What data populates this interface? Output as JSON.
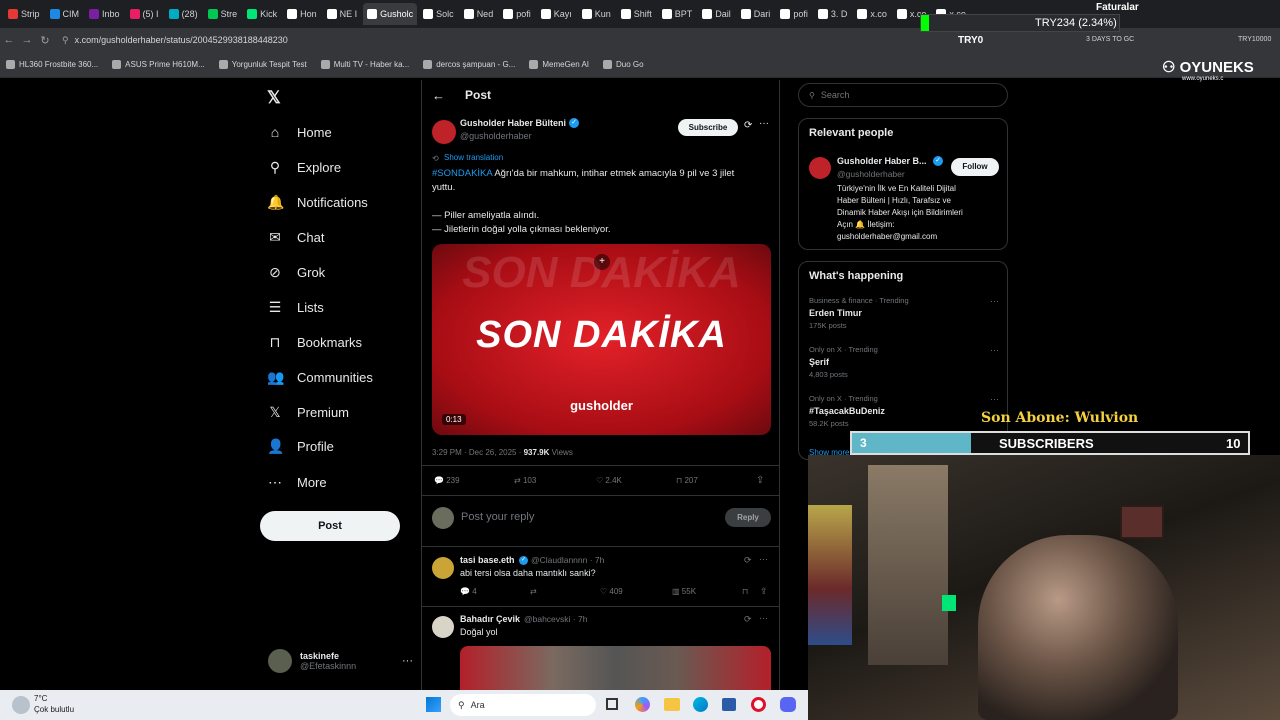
{
  "browser": {
    "tabs": [
      {
        "label": "Strip",
        "color": "#e53935"
      },
      {
        "label": "CIM",
        "color": "#1e88e5"
      },
      {
        "label": "Inbo",
        "color": "#7b1fa2"
      },
      {
        "label": "(5) I",
        "color": "#e91e63"
      },
      {
        "label": "(28)",
        "color": "#00acc1"
      },
      {
        "label": "Stre",
        "color": "#00c853"
      },
      {
        "label": "Kick",
        "color": "#00e676"
      },
      {
        "label": "Hon",
        "color": "#fff"
      },
      {
        "label": "NE I",
        "color": "#fff"
      },
      {
        "label": "Gusholc",
        "color": "#fff",
        "active": true
      },
      {
        "label": "Solc",
        "color": "#fff"
      },
      {
        "label": "Ned",
        "color": "#fff"
      },
      {
        "label": "pofi",
        "color": "#fff"
      },
      {
        "label": "Kayı",
        "color": "#fff"
      },
      {
        "label": "Kun",
        "color": "#fff"
      },
      {
        "label": "Shift",
        "color": "#fff"
      },
      {
        "label": "BPT",
        "color": "#fff"
      },
      {
        "label": "Dail",
        "color": "#fff"
      },
      {
        "label": "Dari",
        "color": "#fff"
      },
      {
        "label": "pofi",
        "color": "#fff"
      },
      {
        "label": "3. D",
        "color": "#fff"
      },
      {
        "label": "x.co",
        "color": "#fff"
      },
      {
        "label": "x.co",
        "color": "#fff"
      },
      {
        "label": "x.co",
        "color": "#fff"
      }
    ],
    "url": "x.com/gusholderhaber/status/2004529938188448230",
    "ticker": "TRY234 (2.34%)",
    "ticker_label": "TRY0",
    "toolbar_text": "3 DAYS TO GC",
    "toolbar_right": "TRY10000"
  },
  "bookmarks": [
    "HL360 Frostbite 360...",
    "ASUS Prime H610M...",
    "Yorgunluk Tespit Test",
    "Multi TV - Haber ka...",
    "dercos şampuan - G...",
    "MemeGen AI",
    "Duo Go"
  ],
  "overlay": {
    "brand": "OYUNEKS",
    "brand_url": "www.oyuneks.c",
    "faturalar": "Faturalar",
    "last_sub": "Son Abone: Wulvion",
    "sub_current": "3",
    "sub_label": "SUBSCRIBERS",
    "sub_goal": "10",
    "sub_fraction": 0.3
  },
  "nav": {
    "items": [
      "Home",
      "Explore",
      "Notifications",
      "Chat",
      "Grok",
      "Lists",
      "Bookmarks",
      "Communities",
      "Premium",
      "Profile",
      "More"
    ],
    "post_label": "Post",
    "account_name": "taskinefe",
    "account_handle": "@Efetaskinnn"
  },
  "main": {
    "header_title": "Post",
    "author_name": "Gusholder Haber Bülteni",
    "author_handle": "@gusholderhaber",
    "subscribe_label": "Subscribe",
    "show_translation": "Show translation",
    "hashtag": "#SONDAKİKA",
    "text_line1": " Ağrı'da bir mahkum, intihar etmek amacıyla 9 pil ve 3 jilet",
    "text_line2": "yuttu.",
    "bullet1": "— Piller ameliyatla alındı.",
    "bullet2": "— Jiletlerin doğal yolla çıkması bekleniyor.",
    "video_title": "SON DAKİKA",
    "video_brand": "gusholder",
    "video_duration": "0:13",
    "timestamp": "3:29 PM · Dec 26, 2025 · ",
    "views_count": "937.9K",
    "views_label": " Views",
    "stats": {
      "replies": "239",
      "reposts": "103",
      "likes": "2.4K",
      "bookmarks": "207"
    },
    "reply_placeholder": "Post your reply",
    "reply_button": "Reply",
    "replies": [
      {
        "name": "tasi base.eth",
        "handle": "@Claudlannnn · 7h",
        "text": "abi tersi olsa daha mantıklı sanki?",
        "replies": "4",
        "likes": "409",
        "views": "55K"
      },
      {
        "name": "Bahadır Çevik",
        "handle": "@bahcevski · 7h",
        "text": "Doğal yol"
      }
    ]
  },
  "right": {
    "search_placeholder": "Search",
    "relevant_title": "Relevant people",
    "person_name": "Gusholder Haber B...",
    "person_handle": "@gusholderhaber",
    "person_bio1": "Türkiye'nin İlk ve En Kaliteli Dijital",
    "person_bio2": "Haber Bülteni | Hızlı, Tarafsız ve",
    "person_bio3": "Dinamik Haber Akışı için Bildirimleri",
    "person_bio4": "Açın 🔔 İletişim:",
    "person_bio5": "gusholderhaber@gmail.com",
    "follow_label": "Follow",
    "happening_title": "What's happening",
    "trends": [
      {
        "context": "Business & finance · Trending",
        "name": "Erden Timur",
        "posts": "175K posts"
      },
      {
        "context": "Only on X · Trending",
        "name": "Şerif",
        "posts": "4,803 posts"
      },
      {
        "context": "Only on X · Trending",
        "name": "#TaşacakBuDeniz",
        "posts": "58.2K posts"
      }
    ],
    "show_more": "Show more"
  },
  "taskbar": {
    "weather_temp": "7°C",
    "weather_desc": "Çok bulutlu",
    "search_label": "Ara"
  }
}
